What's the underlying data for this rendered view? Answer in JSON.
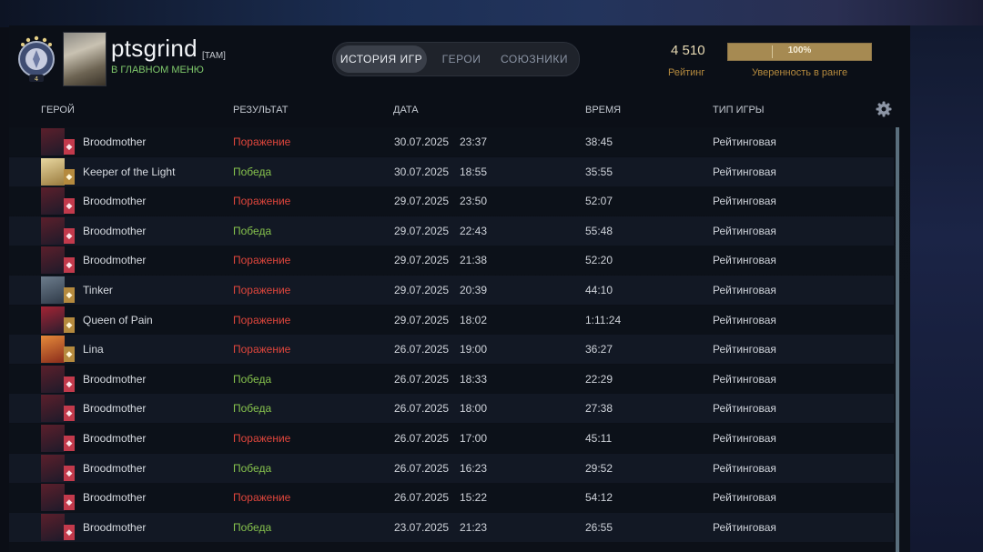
{
  "header": {
    "player_name": "ptsgrind",
    "player_tag": "[TAM]",
    "status": "В ГЛАВНОМ МЕНЮ",
    "rank_medal_icon": "immortal-rank-medal",
    "rank_number": "4",
    "rating_value": "4 510",
    "rating_label": "Рейтинг",
    "confidence_value": "100%",
    "confidence_fraction": 1.0,
    "confidence_label": "Уверенность в ранге"
  },
  "tabs": [
    {
      "label": "ИСТОРИЯ ИГР",
      "active": true
    },
    {
      "label": "ГЕРОИ",
      "active": false
    },
    {
      "label": "СОЮЗНИКИ",
      "active": false
    }
  ],
  "columns": {
    "hero": "ГЕРОЙ",
    "result": "РЕЗУЛЬТАТ",
    "date": "ДАТА",
    "duration": "ВРЕМЯ",
    "game_type": "ТИП ИГРЫ"
  },
  "colors": {
    "loss": "#e0463c",
    "win": "#86c24d",
    "accent_gold": "#b58a3e",
    "status_green": "#7fc96b"
  },
  "matches": [
    {
      "hero": "Broodmother",
      "hero_icon": "broodmother-portrait",
      "attr_icon": "universal-attr-icon",
      "result": "Поражение",
      "outcome": "loss",
      "date": "30.07.2025",
      "time": "23:37",
      "duration": "38:45",
      "type": "Рейтинговая"
    },
    {
      "hero": "Keeper of the Light",
      "hero_icon": "keeper-of-the-light-portrait",
      "attr_icon": "intelligence-attr-icon",
      "result": "Победа",
      "outcome": "win",
      "date": "30.07.2025",
      "time": "18:55",
      "duration": "35:55",
      "type": "Рейтинговая"
    },
    {
      "hero": "Broodmother",
      "hero_icon": "broodmother-portrait",
      "attr_icon": "universal-attr-icon",
      "result": "Поражение",
      "outcome": "loss",
      "date": "29.07.2025",
      "time": "23:50",
      "duration": "52:07",
      "type": "Рейтинговая"
    },
    {
      "hero": "Broodmother",
      "hero_icon": "broodmother-portrait",
      "attr_icon": "universal-attr-icon",
      "result": "Победа",
      "outcome": "win",
      "date": "29.07.2025",
      "time": "22:43",
      "duration": "55:48",
      "type": "Рейтинговая"
    },
    {
      "hero": "Broodmother",
      "hero_icon": "broodmother-portrait",
      "attr_icon": "universal-attr-icon",
      "result": "Поражение",
      "outcome": "loss",
      "date": "29.07.2025",
      "time": "21:38",
      "duration": "52:20",
      "type": "Рейтинговая"
    },
    {
      "hero": "Tinker",
      "hero_icon": "tinker-portrait",
      "attr_icon": "intelligence-attr-icon",
      "result": "Поражение",
      "outcome": "loss",
      "date": "29.07.2025",
      "time": "20:39",
      "duration": "44:10",
      "type": "Рейтинговая"
    },
    {
      "hero": "Queen of Pain",
      "hero_icon": "queen-of-pain-portrait",
      "attr_icon": "intelligence-attr-icon",
      "result": "Поражение",
      "outcome": "loss",
      "date": "29.07.2025",
      "time": "18:02",
      "duration": "1:11:24",
      "type": "Рейтинговая"
    },
    {
      "hero": "Lina",
      "hero_icon": "lina-portrait",
      "attr_icon": "intelligence-attr-icon",
      "result": "Поражение",
      "outcome": "loss",
      "date": "26.07.2025",
      "time": "19:00",
      "duration": "36:27",
      "type": "Рейтинговая"
    },
    {
      "hero": "Broodmother",
      "hero_icon": "broodmother-portrait",
      "attr_icon": "universal-attr-icon",
      "result": "Победа",
      "outcome": "win",
      "date": "26.07.2025",
      "time": "18:33",
      "duration": "22:29",
      "type": "Рейтинговая"
    },
    {
      "hero": "Broodmother",
      "hero_icon": "broodmother-portrait",
      "attr_icon": "universal-attr-icon",
      "result": "Победа",
      "outcome": "win",
      "date": "26.07.2025",
      "time": "18:00",
      "duration": "27:38",
      "type": "Рейтинговая"
    },
    {
      "hero": "Broodmother",
      "hero_icon": "broodmother-portrait",
      "attr_icon": "universal-attr-icon",
      "result": "Поражение",
      "outcome": "loss",
      "date": "26.07.2025",
      "time": "17:00",
      "duration": "45:11",
      "type": "Рейтинговая"
    },
    {
      "hero": "Broodmother",
      "hero_icon": "broodmother-portrait",
      "attr_icon": "universal-attr-icon",
      "result": "Победа",
      "outcome": "win",
      "date": "26.07.2025",
      "time": "16:23",
      "duration": "29:52",
      "type": "Рейтинговая"
    },
    {
      "hero": "Broodmother",
      "hero_icon": "broodmother-portrait",
      "attr_icon": "universal-attr-icon",
      "result": "Поражение",
      "outcome": "loss",
      "date": "26.07.2025",
      "time": "15:22",
      "duration": "54:12",
      "type": "Рейтинговая"
    },
    {
      "hero": "Broodmother",
      "hero_icon": "broodmother-portrait",
      "attr_icon": "universal-attr-icon",
      "result": "Победа",
      "outcome": "win",
      "date": "23.07.2025",
      "time": "21:23",
      "duration": "26:55",
      "type": "Рейтинговая"
    }
  ]
}
